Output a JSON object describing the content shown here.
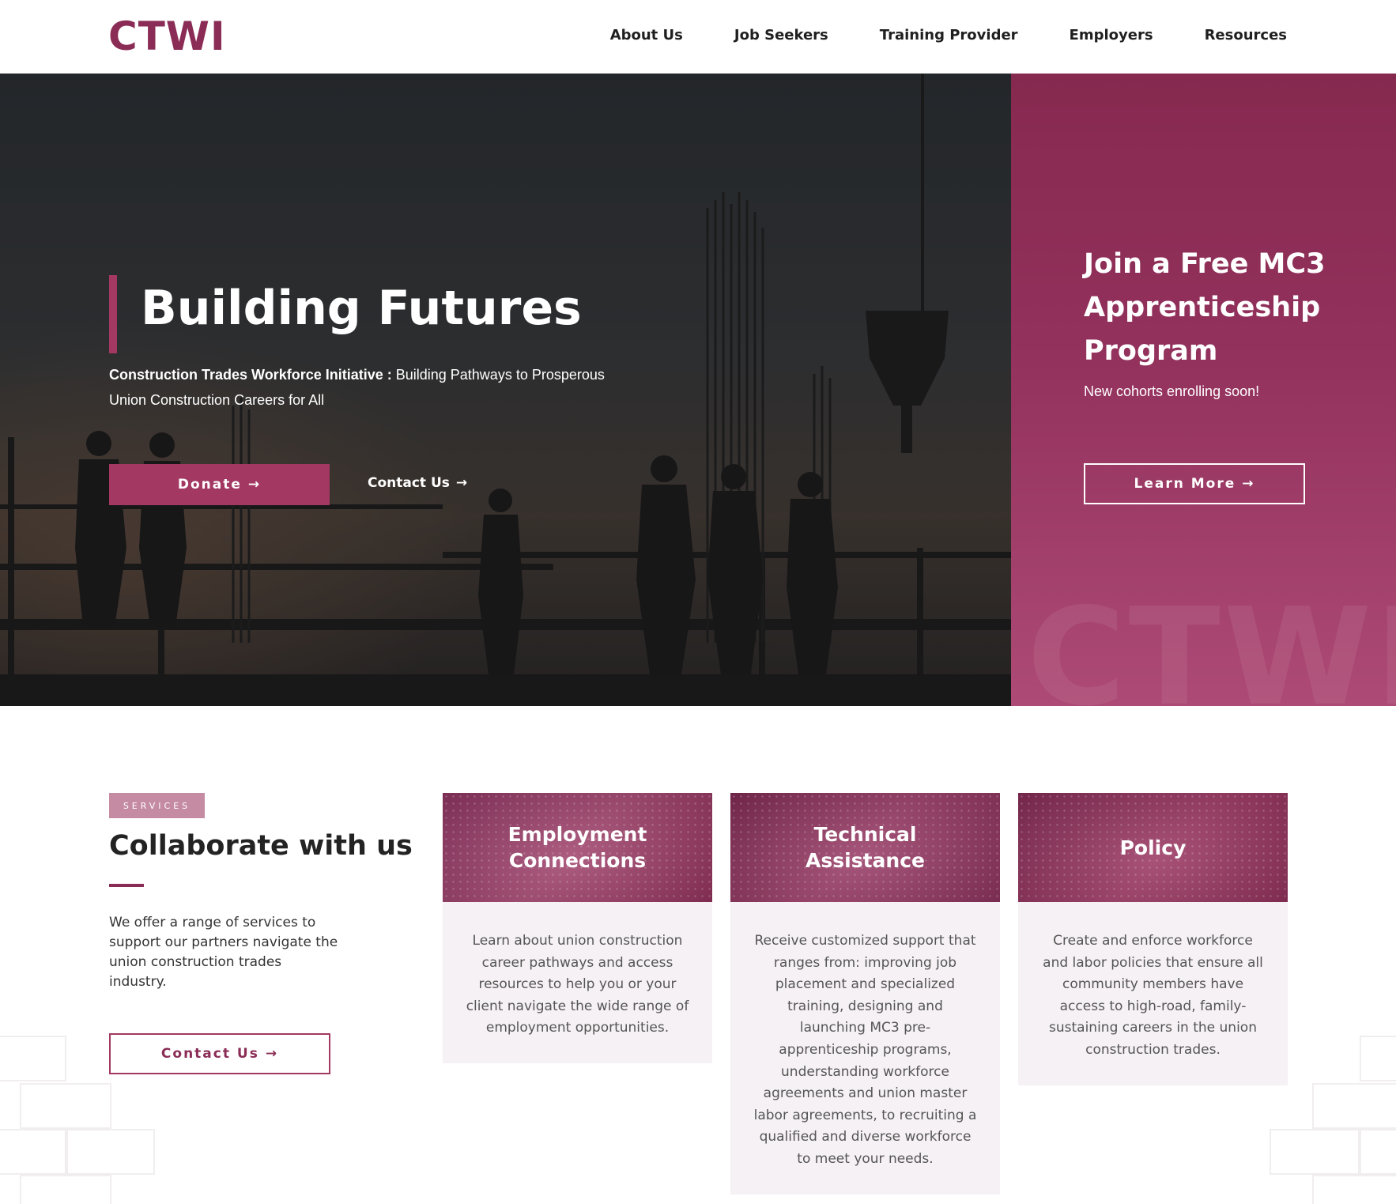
{
  "header": {
    "logo_text": "CTWI",
    "nav": [
      "About Us",
      "Job Seekers",
      "Training Provider",
      "Employers",
      "Resources"
    ]
  },
  "hero": {
    "title": "Building Futures",
    "subtitle_bold": "Construction Trades Workforce Initiative :",
    "subtitle_rest": " Building Pathways to Prosperous Union Construction Careers for All",
    "donate_label": "Donate",
    "contact_label": "Contact Us"
  },
  "promo": {
    "title": "Join a Free MC3 Apprenticeship Program",
    "subtitle": "New cohorts enrolling soon!",
    "button_label": "Learn More",
    "watermark": "CTWI"
  },
  "services": {
    "badge": "SERVICES",
    "title": "Collaborate with us",
    "description": "We offer a range of services to support our partners navigate the union construction trades industry.",
    "contact_label": "Contact Us",
    "cards": [
      {
        "title": "Employment Connections",
        "text": "Learn about union construction career pathways and access resources to help you or your client navigate the wide range of employment opportunities."
      },
      {
        "title": "Technical Assistance",
        "text": "Receive customized support that ranges from: improving job placement and specialized training, designing and launching MC3 pre-apprenticeship programs, understanding workforce agreements and union master labor agreements, to recruiting a qualified and diverse workforce to meet your needs."
      },
      {
        "title": "Policy",
        "text": "Create and enforce workforce and labor policies that ensure all community members have access to high-road, family-sustaining careers in the union construction trades."
      }
    ]
  },
  "icons": {
    "arrow": "arrow-right-icon"
  },
  "colors": {
    "brand": "#8a2c55",
    "accent": "#a33863",
    "card_bg": "#f6f1f4"
  }
}
